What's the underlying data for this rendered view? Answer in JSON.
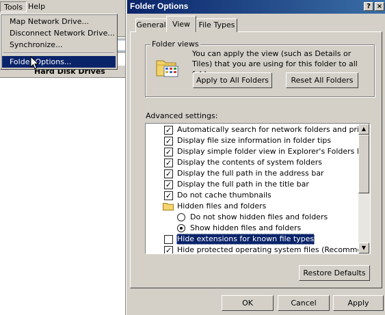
{
  "menubar": {
    "items": [
      "Tools",
      "Help"
    ]
  },
  "tools_menu": {
    "items": [
      "Map Network Drive...",
      "Disconnect Network Drive...",
      "Synchronize...",
      "Folder Options..."
    ],
    "selected": "Folder Options..."
  },
  "explorer": {
    "section_header": "Hard Disk Drives"
  },
  "dialog": {
    "title": "Folder Options",
    "title_buttons": [
      "?",
      "×"
    ],
    "tabs": [
      "General",
      "View",
      "File Types"
    ],
    "active_tab": "View",
    "folder_views": {
      "group_title": "Folder views",
      "description": "You can apply the view (such as Details or Tiles) that you are using for this folder to all folders.",
      "apply_button": "Apply to All Folders",
      "reset_button": "Reset All Folders"
    },
    "advanced": {
      "label": "Advanced settings:",
      "items": [
        {
          "type": "checkbox",
          "label": "Automatically search for network folders and printers",
          "checked": true
        },
        {
          "type": "checkbox",
          "label": "Display file size information in folder tips",
          "checked": true
        },
        {
          "type": "checkbox",
          "label": "Display simple folder view in Explorer's Folders list",
          "checked": true
        },
        {
          "type": "checkbox",
          "label": "Display the contents of system folders",
          "checked": true
        },
        {
          "type": "checkbox",
          "label": "Display the full path in the address bar",
          "checked": true
        },
        {
          "type": "checkbox",
          "label": "Display the full path in the title bar",
          "checked": true
        },
        {
          "type": "checkbox",
          "label": "Do not cache thumbnails",
          "checked": true
        },
        {
          "type": "folder",
          "label": "Hidden files and folders"
        },
        {
          "type": "radio",
          "label": "Do not show hidden files and folders",
          "checked": false
        },
        {
          "type": "radio",
          "label": "Show hidden files and folders",
          "checked": true
        },
        {
          "type": "checkbox",
          "label": "Hide extensions for known file types",
          "checked": false,
          "highlighted": true
        },
        {
          "type": "checkbox",
          "label": "Hide protected operating system files (Recommended)",
          "checked": true
        }
      ],
      "restore_button": "Restore Defaults"
    },
    "buttons": {
      "ok": "OK",
      "cancel": "Cancel",
      "apply": "Apply"
    }
  }
}
